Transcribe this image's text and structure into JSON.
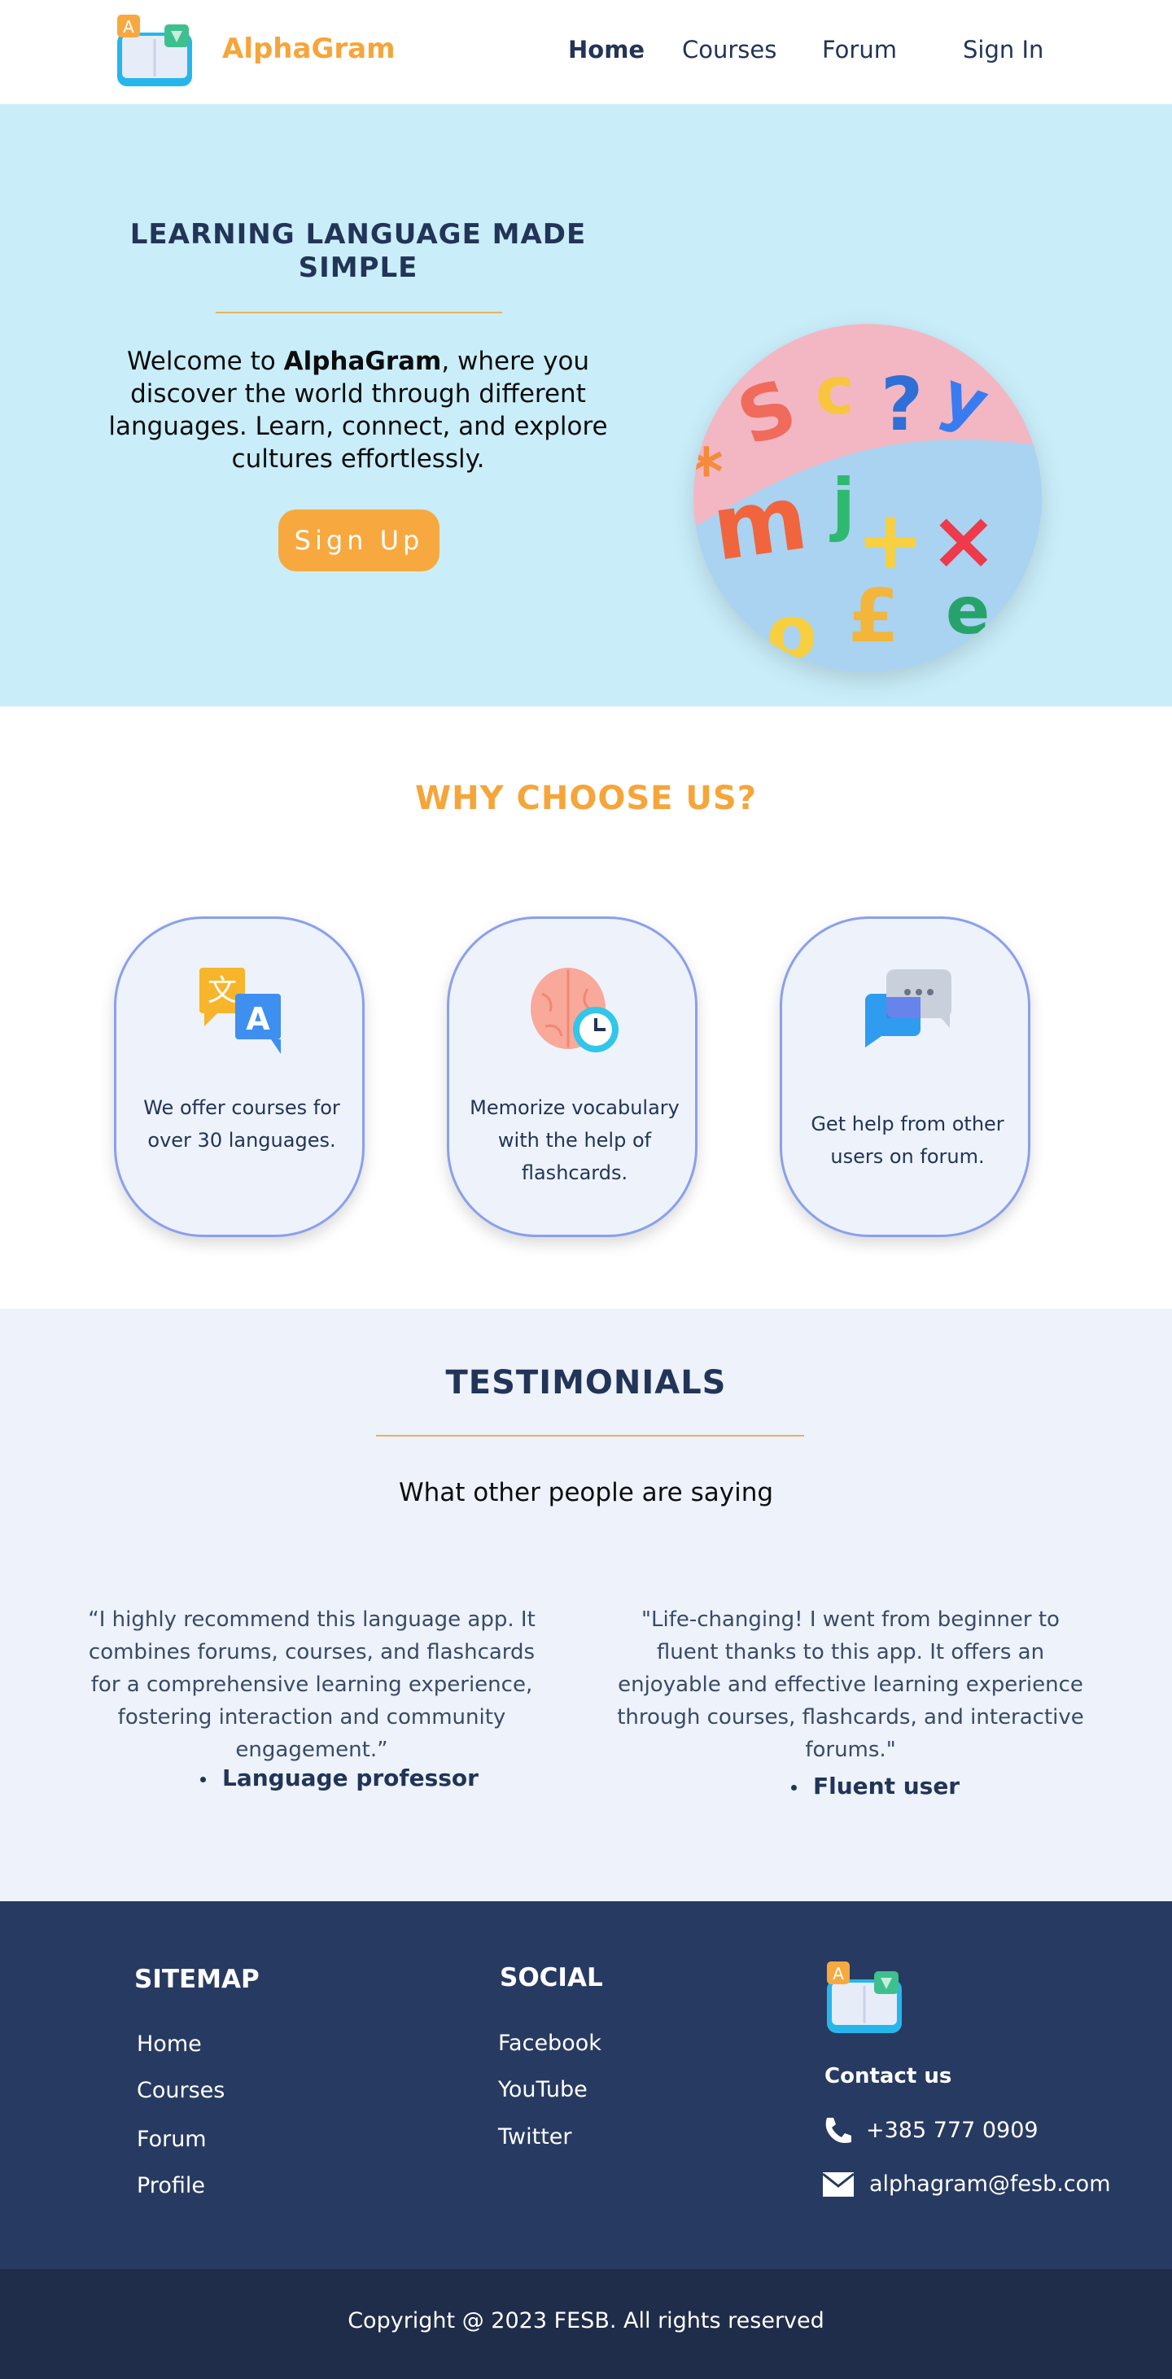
{
  "nav": {
    "brand": "AlphaGram",
    "links": [
      "Home",
      "Courses",
      "Forum",
      "Sign In"
    ]
  },
  "hero": {
    "title": "LEARNING LANGUAGE MADE SIMPLE",
    "text_before": "Welcome to ",
    "text_brand": "AlphaGram",
    "text_after": ", where you discover the world through different languages. Learn, connect, and explore cultures effortlessly.",
    "signup_label": "Sign Up"
  },
  "why": {
    "title": "WHY CHOOSE US?",
    "cards": [
      {
        "text": "We offer courses for over 30 languages.",
        "icon": "translate-icon"
      },
      {
        "text": "Memorize vocabulary with the help of flashcards.",
        "icon": "brain-clock-icon"
      },
      {
        "text": "Get help from other users on forum.",
        "icon": "chat-icon"
      }
    ]
  },
  "testimonials": {
    "title": "TESTIMONIALS",
    "subtitle": "What other people are saying",
    "items": [
      {
        "quote": "“I highly recommend this language app. It combines forums, courses, and flashcards for a comprehensive learning experience, fostering interaction and community engagement.”",
        "author": "Language professor"
      },
      {
        "quote": "\"Life-changing! I went from beginner to fluent thanks to this app. It offers an enjoyable and effective learning experience through courses, flashcards, and interactive forums.\"",
        "author": "Fluent user"
      }
    ]
  },
  "footer": {
    "sitemap_title": "SITEMAP",
    "sitemap_links": [
      "Home",
      "Courses",
      "Forum",
      "Profile"
    ],
    "social_title": "SOCIAL",
    "social_links": [
      "Facebook",
      "YouTube",
      "Twitter"
    ],
    "contact_title": "Contact us",
    "phone": "+385 777 0909",
    "email": "alphagram@fesb.com",
    "copyright": "Copyright @ 2023 FESB. All rights reserved"
  },
  "colors": {
    "accent": "#f6a53a",
    "navy": "#223457",
    "hero_bg": "#c9eefa",
    "footer_bg": "#273a61"
  }
}
